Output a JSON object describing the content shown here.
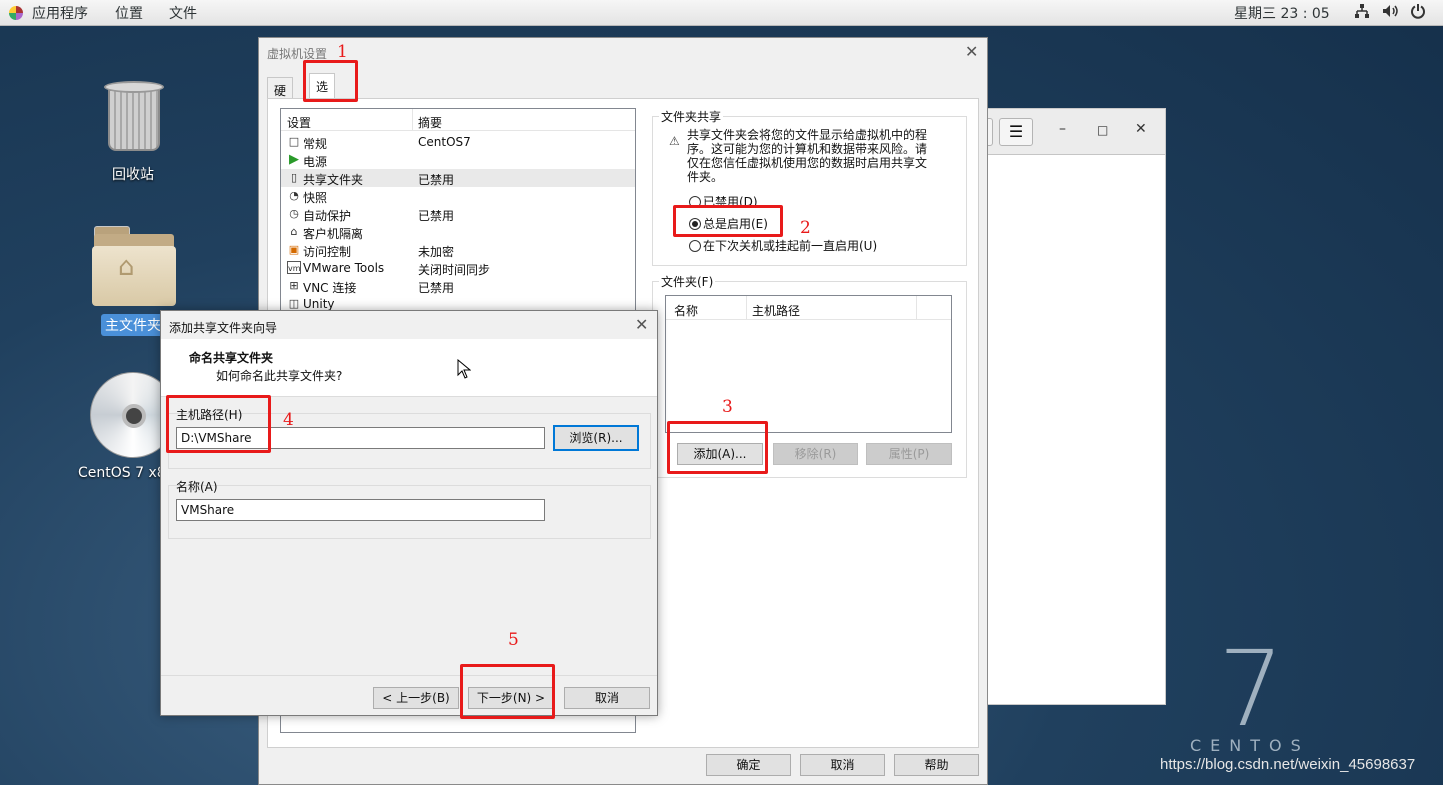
{
  "topbar": {
    "apps": "应用程序",
    "places": "位置",
    "files": "文件",
    "clock": "星期三 23 : 05",
    "icons": [
      "network-icon",
      "volume-icon",
      "power-icon"
    ]
  },
  "desktop": {
    "trash": "回收站",
    "home": "主文件夹",
    "disc": "CentOS 7 x8"
  },
  "watermark": {
    "seven": "7",
    "word": "CENTOS",
    "url": "https://blog.csdn.net/weixin_45698637"
  },
  "vm_settings": {
    "title": "虚拟机设置",
    "tabs": [
      "硬件",
      "选项"
    ],
    "list_headers": [
      "设置",
      "摘要"
    ],
    "rows": [
      {
        "icon": "general-icon",
        "glyph": "□",
        "name": "常规",
        "value": "CentOS7"
      },
      {
        "icon": "power-icon",
        "glyph": "▶",
        "name": "电源",
        "value": ""
      },
      {
        "icon": "shared-folder-icon",
        "glyph": "▯",
        "name": "共享文件夹",
        "value": "已禁用"
      },
      {
        "icon": "snapshot-icon",
        "glyph": "◔",
        "name": "快照",
        "value": ""
      },
      {
        "icon": "autoprotect-icon",
        "glyph": "◷",
        "name": "自动保护",
        "value": "已禁用"
      },
      {
        "icon": "isolation-icon",
        "glyph": "⌂",
        "name": "客户机隔离",
        "value": ""
      },
      {
        "icon": "access-control-icon",
        "glyph": "▣",
        "name": "访问控制",
        "value": "未加密"
      },
      {
        "icon": "vmware-tools-icon",
        "glyph": "vm",
        "name": "VMware Tools",
        "value": "关闭时间同步"
      },
      {
        "icon": "vnc-icon",
        "glyph": "⊞",
        "name": "VNC 连接",
        "value": "已禁用"
      },
      {
        "icon": "unity-icon",
        "glyph": "◫",
        "name": "Unity",
        "value": ""
      }
    ],
    "sharing_group": "文件夹共享",
    "warning": "共享文件夹会将您的文件显示给虚拟机中的程序。这可能为您的计算机和数据带来风险。请仅在您信任虚拟机使用您的数据时启用共享文件夹。",
    "radio_disabled": "已禁用(D)",
    "radio_always": "总是启用(E)",
    "radio_until": "在下次关机或挂起前一直启用(U)",
    "folders_group": "文件夹(F)",
    "folder_headers": [
      "名称",
      "主机路径"
    ],
    "add": "添加(A)...",
    "remove": "移除(R)",
    "properties": "属性(P)",
    "ok": "确定",
    "cancel": "取消",
    "help": "帮助"
  },
  "wizard": {
    "title": "添加共享文件夹向导",
    "heading": "命名共享文件夹",
    "subheading": "如何命名此共享文件夹?",
    "host_path_label": "主机路径(H)",
    "host_path_value": "D:\\VMShare",
    "browse": "浏览(R)...",
    "name_label": "名称(A)",
    "name_value": "VMShare",
    "back": "< 上一步(B)",
    "next": "下一步(N) >",
    "cancel": "取消"
  },
  "annotations": [
    "1",
    "2",
    "3",
    "4",
    "5"
  ],
  "colors": {
    "annotation": "#e81a1a",
    "selection": "#4a90d9",
    "default_button_border": "#0078d7"
  }
}
